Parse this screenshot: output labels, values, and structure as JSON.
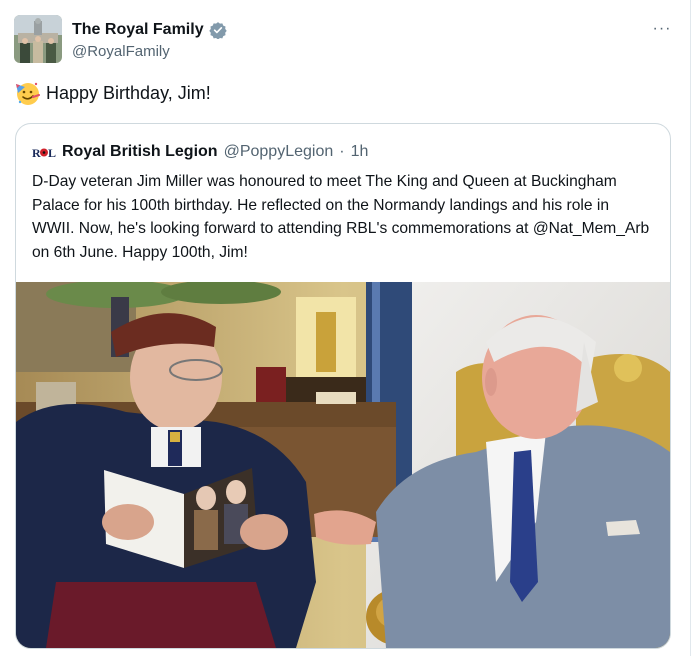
{
  "account": {
    "display_name": "The Royal Family",
    "handle": "@RoyalFamily",
    "verified_icon": "verified-badge-icon"
  },
  "tweet": {
    "text": "Happy Birthday, Jim!",
    "emoji": "party-face-emoji"
  },
  "more_icon": "···",
  "quoted": {
    "logo": "rbl-logo",
    "name": "Royal British Legion",
    "handle": "@PoppyLegion",
    "separator": "·",
    "time": "1h",
    "text": "D-Day veteran Jim Miller was honoured to meet The King and Queen at Buckingham Palace for his 100th birthday. He reflected on the Normandy landings and his role in WWII. Now, he's looking forward to attending RBL's commemorations at @Nat_Mem_Arb on 6th June. Happy 100th, Jim!",
    "image_alt": "photo-veteran-and-king"
  },
  "colors": {
    "text": "#0f1419",
    "secondary": "#536471",
    "border": "#cfd9de",
    "verified": "#829aab"
  }
}
